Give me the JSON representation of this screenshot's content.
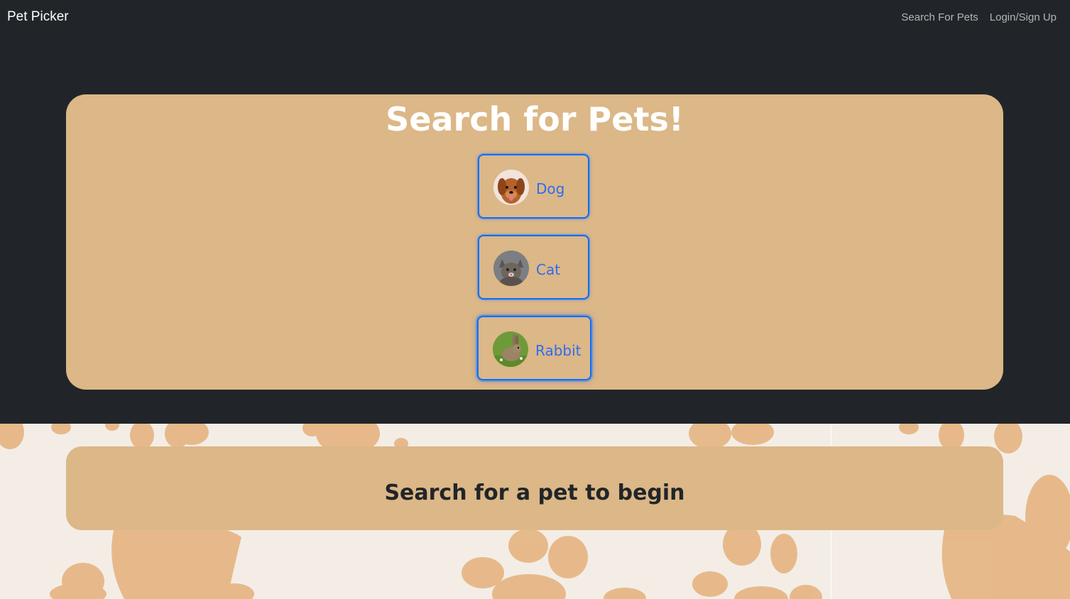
{
  "nav": {
    "brand": "Pet Picker",
    "links": [
      "Search For Pets",
      "Login/Sign Up"
    ]
  },
  "search": {
    "title": "Search for Pets!",
    "pets": [
      {
        "label": "Dog",
        "icon": "dog-photo"
      },
      {
        "label": "Cat",
        "icon": "cat-photo"
      },
      {
        "label": "Rabbit",
        "icon": "rabbit-photo"
      }
    ]
  },
  "results": {
    "message": "Search for a pet to begin"
  },
  "colors": {
    "dark": "#212529",
    "card": "#dcb787",
    "accent": "#0d6efd",
    "paw": "#e6b481",
    "background": "#f3ede6"
  }
}
